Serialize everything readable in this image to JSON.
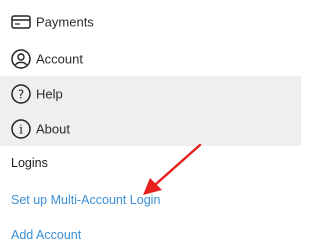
{
  "menu": {
    "items": [
      {
        "label": "Payments",
        "icon": "credit-card-icon"
      },
      {
        "label": "Account",
        "icon": "user-circle-icon"
      },
      {
        "label": "Help",
        "icon": "question-circle-icon"
      },
      {
        "label": "About",
        "icon": "info-circle-icon"
      }
    ]
  },
  "logins": {
    "section_title": "Logins",
    "setup_link": "Set up Multi-Account Login",
    "add_account": "Add Account"
  },
  "colors": {
    "link": "#3b8fd6",
    "annotation_arrow": "#e8201c",
    "shaded_row": "#efefef"
  }
}
